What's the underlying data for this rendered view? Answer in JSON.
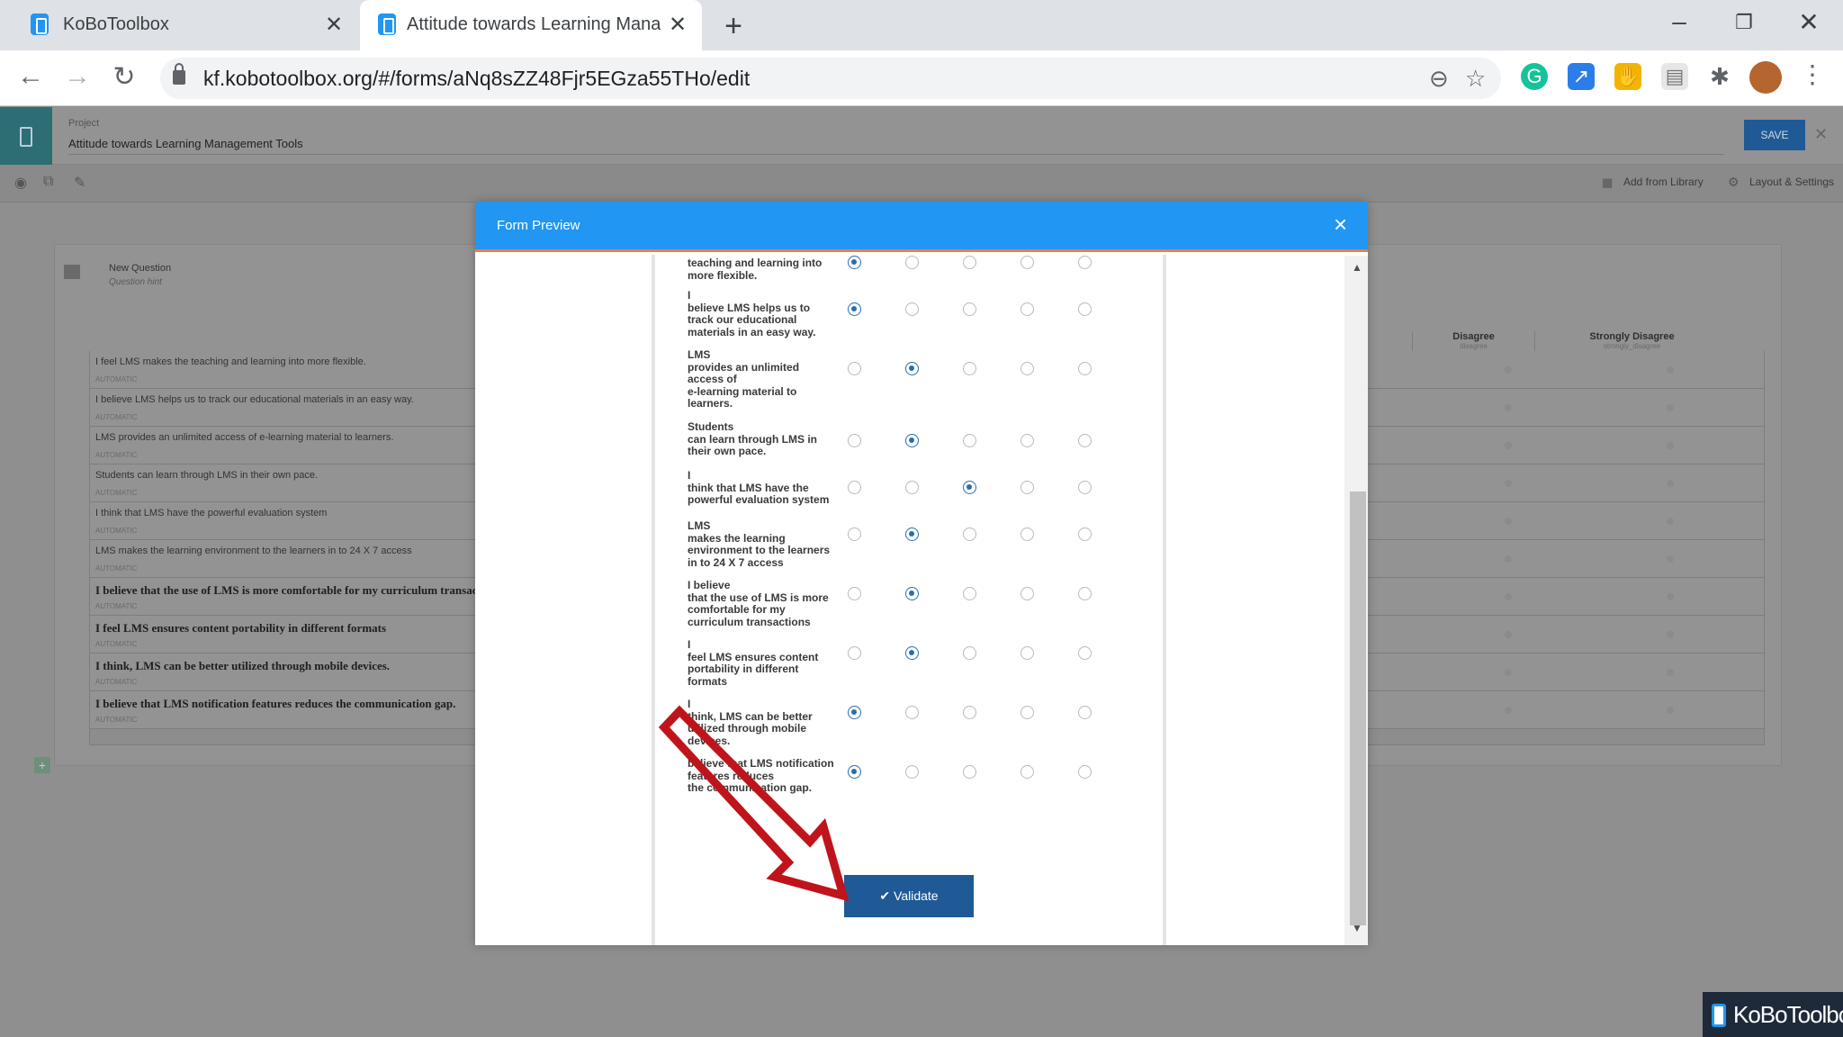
{
  "browser": {
    "tabs": [
      {
        "title": "KoBoToolbox"
      },
      {
        "title": "Attitude towards Learning Manag"
      }
    ],
    "url": "kf.kobotoolbox.org/#/forms/aNq8sZZ48Fjr5EGza55THo/edit"
  },
  "app": {
    "project_label": "Project",
    "project_name": "Attitude towards Learning Management Tools",
    "save_label": "SAVE",
    "add_from_library": "Add from Library",
    "layout_settings": "Layout & Settings",
    "new_question": "New Question",
    "question_hint": "Question hint",
    "columns": [
      {
        "label": "Disagree",
        "name": "disagree"
      },
      {
        "label": "Strongly Disagree",
        "name": "strongly_disagree"
      }
    ],
    "automatic": "AUTOMATIC",
    "rows": [
      "I feel LMS makes the teaching  and learning into more flexible.",
      "I believe LMS helps us to track our educational materials in an easy way.",
      "LMS provides an unlimited access of    e-learning material to learners.",
      "Students can learn through LMS in their own pace.",
      "I think that LMS have the powerful evaluation system",
      "LMS makes the learning environment to the learners in to 24 X 7 access",
      "I believe that the use of LMS is more comfortable for my curriculum transacti",
      "I feel LMS ensures content portability in different formats",
      "I think, LMS can be better utilized through mobile devices.",
      "I believe that LMS notification features reduces  the  communication gap."
    ]
  },
  "modal": {
    "title": "Form Preview",
    "validate_label": "✔ Validate",
    "questions": [
      {
        "lines": [
          "teaching  and learning into",
          "more flexible."
        ],
        "selected": 0
      },
      {
        "lines": [
          "I",
          "believe LMS helps us to",
          "track our educational",
          "materials in an easy way."
        ],
        "selected": 0
      },
      {
        "lines": [
          "LMS",
          "provides an unlimited",
          "access of",
          "e-learning material to",
          "learners."
        ],
        "selected": 1
      },
      {
        "lines": [
          "Students",
          "can learn through LMS in",
          "their own pace."
        ],
        "selected": 1
      },
      {
        "lines": [
          "I",
          "think that LMS have the",
          "powerful evaluation system"
        ],
        "selected": 2
      },
      {
        "lines": [
          "LMS",
          "makes the learning",
          "environment to the learners",
          "in to 24 X 7 access"
        ],
        "selected": 1
      },
      {
        "lines": [
          "I believe",
          "that the use of LMS is more",
          "comfortable for my",
          "curriculum transactions"
        ],
        "selected": 1
      },
      {
        "lines": [
          "I",
          "feel LMS ensures content",
          "portability in different",
          "formats"
        ],
        "selected": 1
      },
      {
        "lines": [
          "I",
          "think, LMS can be better",
          "utilized through mobile",
          "devices."
        ],
        "selected": 0
      },
      {
        "lines": [
          "believe that LMS notification",
          "features reduces",
          "the  communication gap."
        ],
        "selected": 0
      }
    ]
  },
  "watermark": "KoBoToolbox",
  "colors": {
    "accent": "#2196f3",
    "button": "#1f5a96",
    "arrow": "#c0141c"
  }
}
